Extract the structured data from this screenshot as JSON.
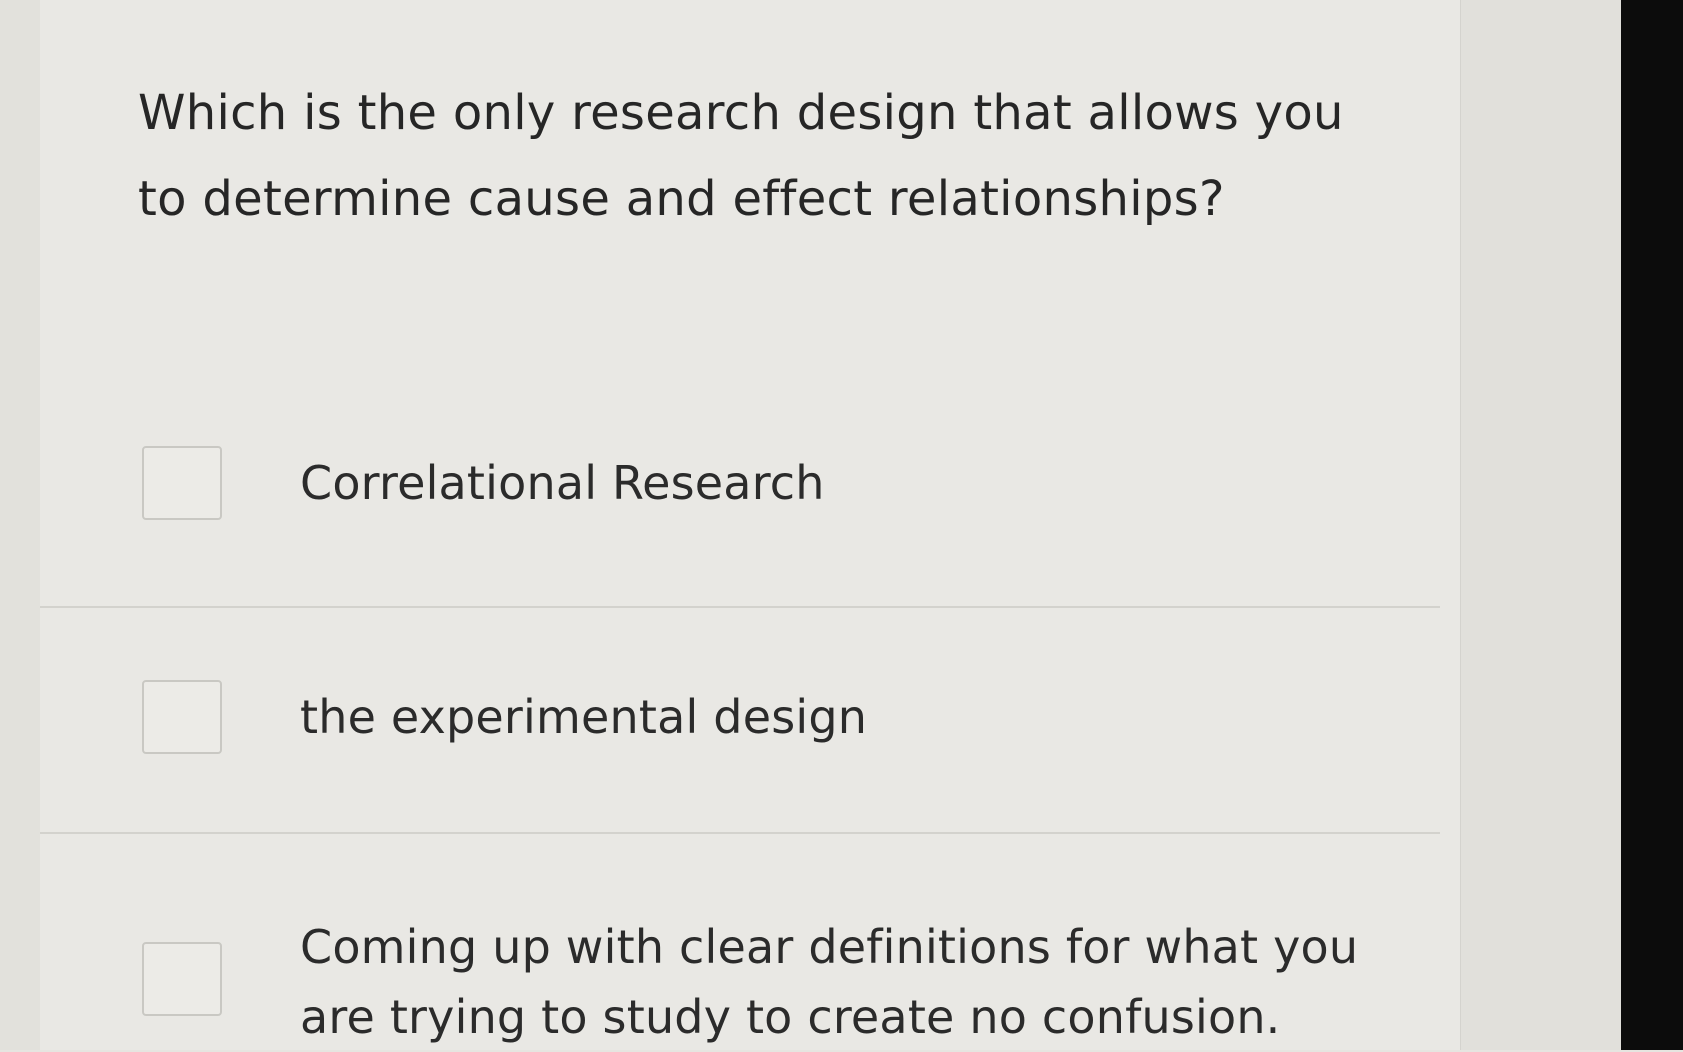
{
  "question": {
    "text": "Which is the only research design that allows you to determine cause and effect relationships?"
  },
  "options": [
    {
      "label": "Correlational Research",
      "checked": false
    },
    {
      "label": "the experimental design",
      "checked": false
    },
    {
      "label": "Coming up with clear definitions for what you are trying to study to create no confusion.",
      "checked": false
    }
  ],
  "colors": {
    "page_background": "#e9e8e4",
    "text": "#2b2b2b",
    "checkbox_border": "#c9c8c3",
    "divider": "#d3d2cd",
    "bezel": "#0c0c0c"
  }
}
